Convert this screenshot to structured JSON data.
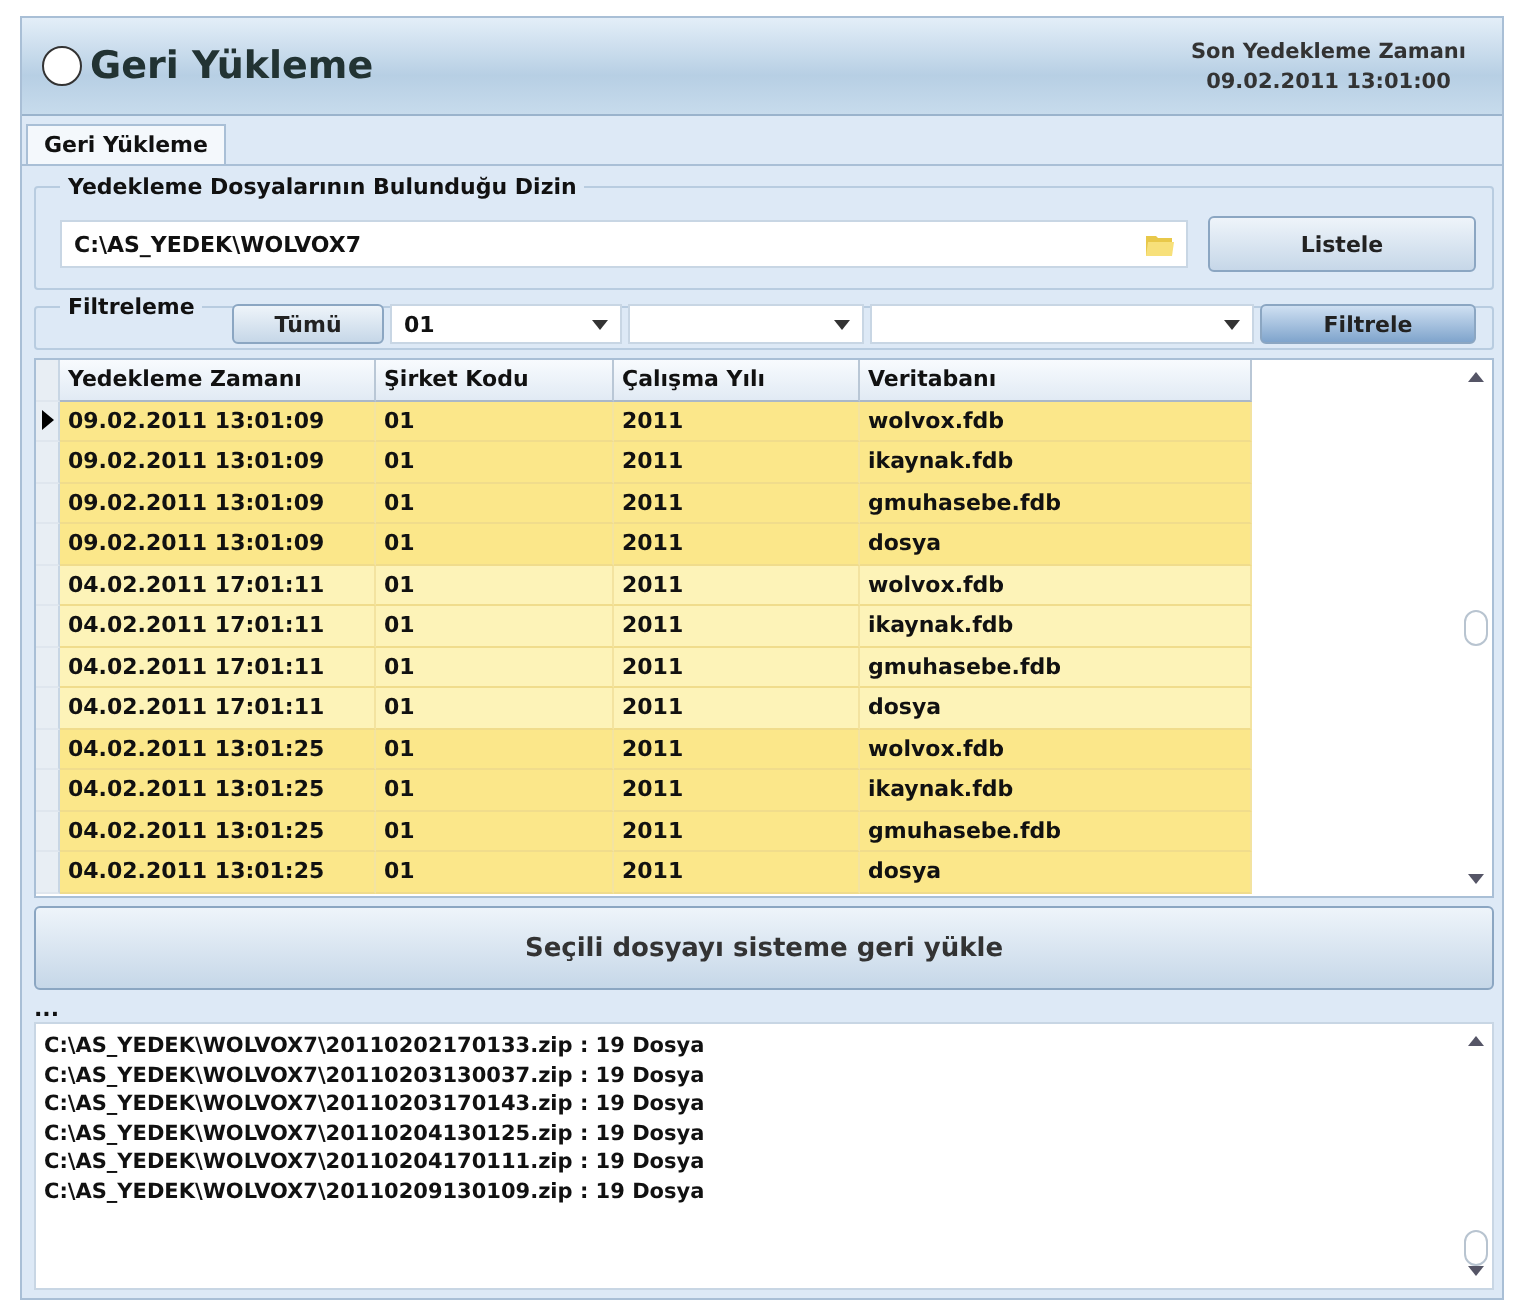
{
  "header": {
    "title": "Geri Yükleme",
    "last_backup_label": "Son Yedekleme Zamanı",
    "last_backup_time": "09.02.2011 13:01:00"
  },
  "tabs": [
    {
      "label": "Geri Yükleme",
      "selected": true
    }
  ],
  "directory_group": {
    "title": "Yedekleme Dosyalarının Bulunduğu Dizin",
    "path": "C:\\AS_YEDEK\\WOLVOX7",
    "list_button": "Listele"
  },
  "filter_group": {
    "title": "Filtreleme",
    "all_button": "Tümü",
    "dropdowns": [
      {
        "kind": "filled",
        "value": "01"
      },
      {
        "kind": "empty"
      },
      {
        "kind": "empty"
      }
    ],
    "filter_button": "Filtrele"
  },
  "table": {
    "columns": [
      "Yedekleme Zamanı",
      "Şirket Kodu",
      "Çalışma Yılı",
      "Veritabanı"
    ],
    "rows": [
      {
        "cells": [
          "09.02.2011 13:01:09",
          "01",
          "2011",
          "wolvox.fdb"
        ],
        "selected": true,
        "color": "#fbe78a"
      },
      {
        "cells": [
          "09.02.2011 13:01:09",
          "01",
          "2011",
          "ikaynak.fdb"
        ],
        "selected": false,
        "color": "#fbe78a"
      },
      {
        "cells": [
          "09.02.2011 13:01:09",
          "01",
          "2011",
          "gmuhasebe.fdb"
        ],
        "selected": false,
        "color": "#fbe78a"
      },
      {
        "cells": [
          "09.02.2011 13:01:09",
          "01",
          "2011",
          "dosya"
        ],
        "selected": false,
        "color": "#fbe78a"
      },
      {
        "cells": [
          "04.02.2011 17:01:11",
          "01",
          "2011",
          "wolvox.fdb"
        ],
        "selected": false,
        "color": "#fdf3b8"
      },
      {
        "cells": [
          "04.02.2011 17:01:11",
          "01",
          "2011",
          "ikaynak.fdb"
        ],
        "selected": false,
        "color": "#fdf3b8"
      },
      {
        "cells": [
          "04.02.2011 17:01:11",
          "01",
          "2011",
          "gmuhasebe.fdb"
        ],
        "selected": false,
        "color": "#fdf3b8"
      },
      {
        "cells": [
          "04.02.2011 17:01:11",
          "01",
          "2011",
          "dosya"
        ],
        "selected": false,
        "color": "#fdf3b8"
      },
      {
        "cells": [
          "04.02.2011 13:01:25",
          "01",
          "2011",
          "wolvox.fdb"
        ],
        "selected": false,
        "color": "#fbe78a"
      },
      {
        "cells": [
          "04.02.2011 13:01:25",
          "01",
          "2011",
          "ikaynak.fdb"
        ],
        "selected": false,
        "color": "#fbe78a"
      },
      {
        "cells": [
          "04.02.2011 13:01:25",
          "01",
          "2011",
          "gmuhasebe.fdb"
        ],
        "selected": false,
        "color": "#fbe78a"
      },
      {
        "cells": [
          "04.02.2011 13:01:25",
          "01",
          "2011",
          "dosya"
        ],
        "selected": false,
        "color": "#fbe78a"
      }
    ]
  },
  "restore_button": "Seçili dosyayı sisteme geri yükle",
  "log": {
    "caption": "...",
    "lines": [
      "C:\\AS_YEDEK\\WOLVOX7\\20110202170133.zip : 19 Dosya",
      "C:\\AS_YEDEK\\WOLVOX7\\20110203130037.zip : 19 Dosya",
      "C:\\AS_YEDEK\\WOLVOX7\\20110203170143.zip : 19 Dosya",
      "C:\\AS_YEDEK\\WOLVOX7\\20110204130125.zip : 19 Dosya",
      "C:\\AS_YEDEK\\WOLVOX7\\20110204170111.zip : 19 Dosya",
      "C:\\AS_YEDEK\\WOLVOX7\\20110209130109.zip : 19 Dosya"
    ]
  }
}
